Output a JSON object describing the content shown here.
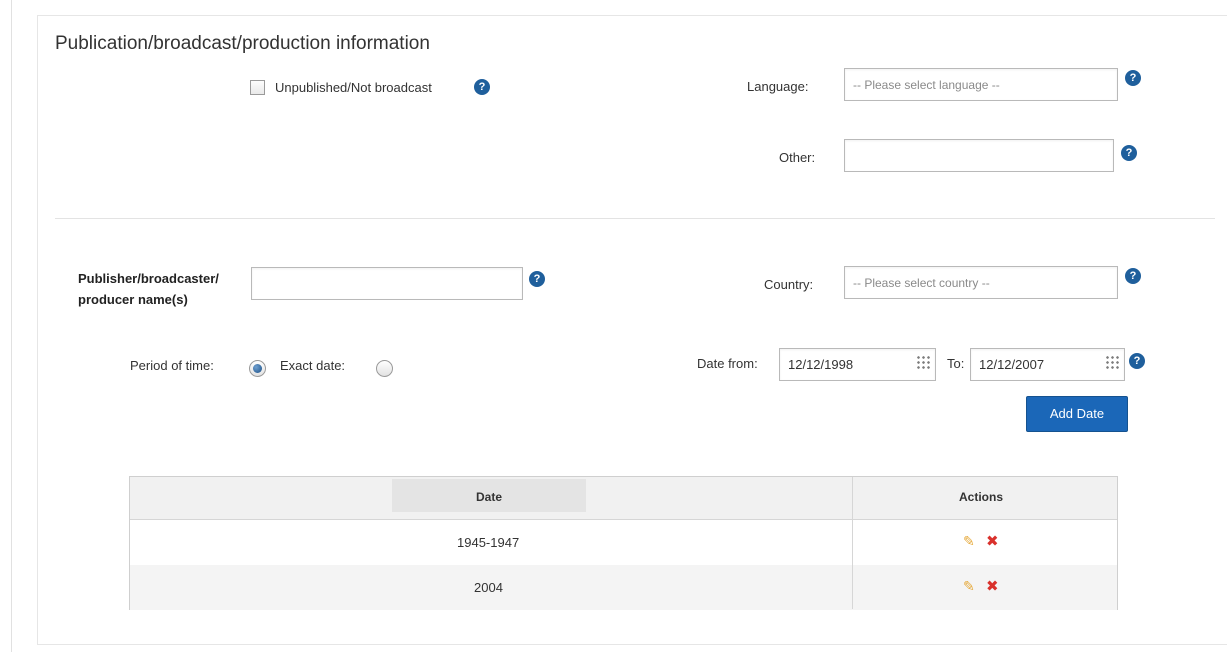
{
  "section": {
    "title": "Publication/broadcast/production information"
  },
  "unpublished": {
    "label": "Unpublished/Not broadcast"
  },
  "language": {
    "label": "Language:",
    "placeholder": "-- Please select language --"
  },
  "other": {
    "label": "Other:",
    "value": ""
  },
  "publisher": {
    "label_line1": "Publisher/broadcaster/",
    "label_line2": "producer name(s)",
    "value": ""
  },
  "country": {
    "label": "Country:",
    "placeholder": "-- Please select country --"
  },
  "period": {
    "label": "Period of time:",
    "selected": true
  },
  "exact_date": {
    "label": "Exact date:",
    "selected": false
  },
  "date_from": {
    "label": "Date from:",
    "value": "12/12/1998"
  },
  "date_to": {
    "label": "To:",
    "value": "12/12/2007"
  },
  "add_date_button": {
    "label": "Add Date"
  },
  "table": {
    "headers": {
      "date": "Date",
      "actions": "Actions"
    },
    "rows": [
      {
        "date": "1945-1947"
      },
      {
        "date": "2004"
      }
    ]
  },
  "icons": {
    "help": "help-circle-icon",
    "edit": "pencil-icon",
    "delete": "x-icon",
    "calendar": "calendar-grid-icon"
  },
  "colors": {
    "accent": "#1b67b8",
    "help": "#1f5f9c",
    "edit": "#e6a93a",
    "delete": "#d9312c"
  }
}
